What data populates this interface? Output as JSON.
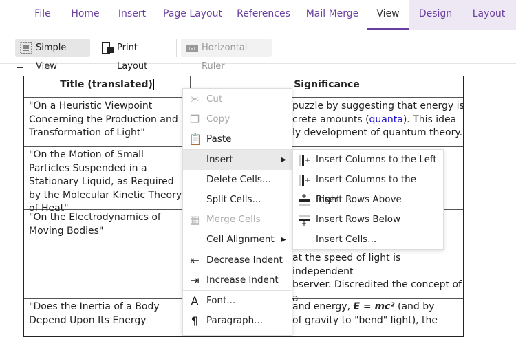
{
  "tabs": [
    "File",
    "Home",
    "Insert",
    "Page Layout",
    "References",
    "Mail Merge",
    "View",
    "Design",
    "Layout"
  ],
  "toolbar": {
    "simple_view": "Simple View",
    "print_layout": "Print Layout",
    "horizontal_ruler": "Horizontal Ruler"
  },
  "table": {
    "headers": [
      "Title (translated)",
      "Significance"
    ],
    "rows": [
      {
        "title": "\"On a Heuristic Viewpoint Concerning the Production and Transformation of Light\"",
        "sig": [
          "puzzle by suggesting that energy is",
          "crete amounts (",
          "quanta",
          "). This idea",
          "ly development of quantum theory."
        ]
      },
      {
        "title": "\"On the Motion of Small Particles Suspended in a Stationary Liquid, as Required by the Molecular Kinetic Theory of Heat\""
      },
      {
        "title": "\"On the Electrodynamics of Moving Bodies\"",
        "sig": [
          "at the speed of light is independent",
          "bserver. Discredited the concept of a"
        ]
      },
      {
        "title": "\"Does the Inertia of a Body Depend Upon Its Energy",
        "sig": [
          "and energy, ",
          "E = mc²",
          " (and by",
          "of gravity to \"bend\" light), the"
        ]
      }
    ]
  },
  "context_menu": [
    "Cut",
    "Copy",
    "Paste",
    "Insert",
    "Delete Cells...",
    "Split Cells...",
    "Merge Cells",
    "Cell Alignment",
    "Decrease Indent",
    "Increase Indent",
    "Font...",
    "Paragraph..."
  ],
  "submenu": [
    "Insert Columns to the Left",
    "Insert Columns to the Right",
    "Insert Rows Above",
    "Insert Rows Below",
    "Insert Cells..."
  ],
  "colors": {
    "accent": "#6b3fa0",
    "link": "#1a0dcc"
  }
}
